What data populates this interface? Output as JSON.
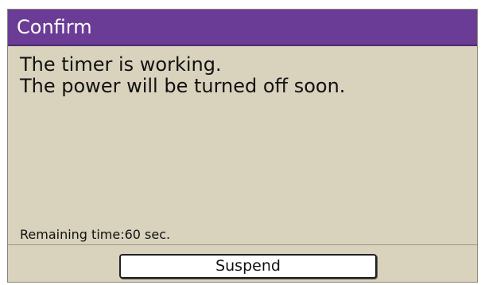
{
  "dialog": {
    "title": "Confirm",
    "message_line1": "The timer is working.",
    "message_line2": "The power will be turned off soon.",
    "remaining_label": "Remaining time:",
    "remaining_value": "60 sec.",
    "suspend_label": "Suspend"
  },
  "colors": {
    "titlebar": "#6b3c95",
    "background": "#d9d2bd",
    "button": "#ffffff"
  }
}
